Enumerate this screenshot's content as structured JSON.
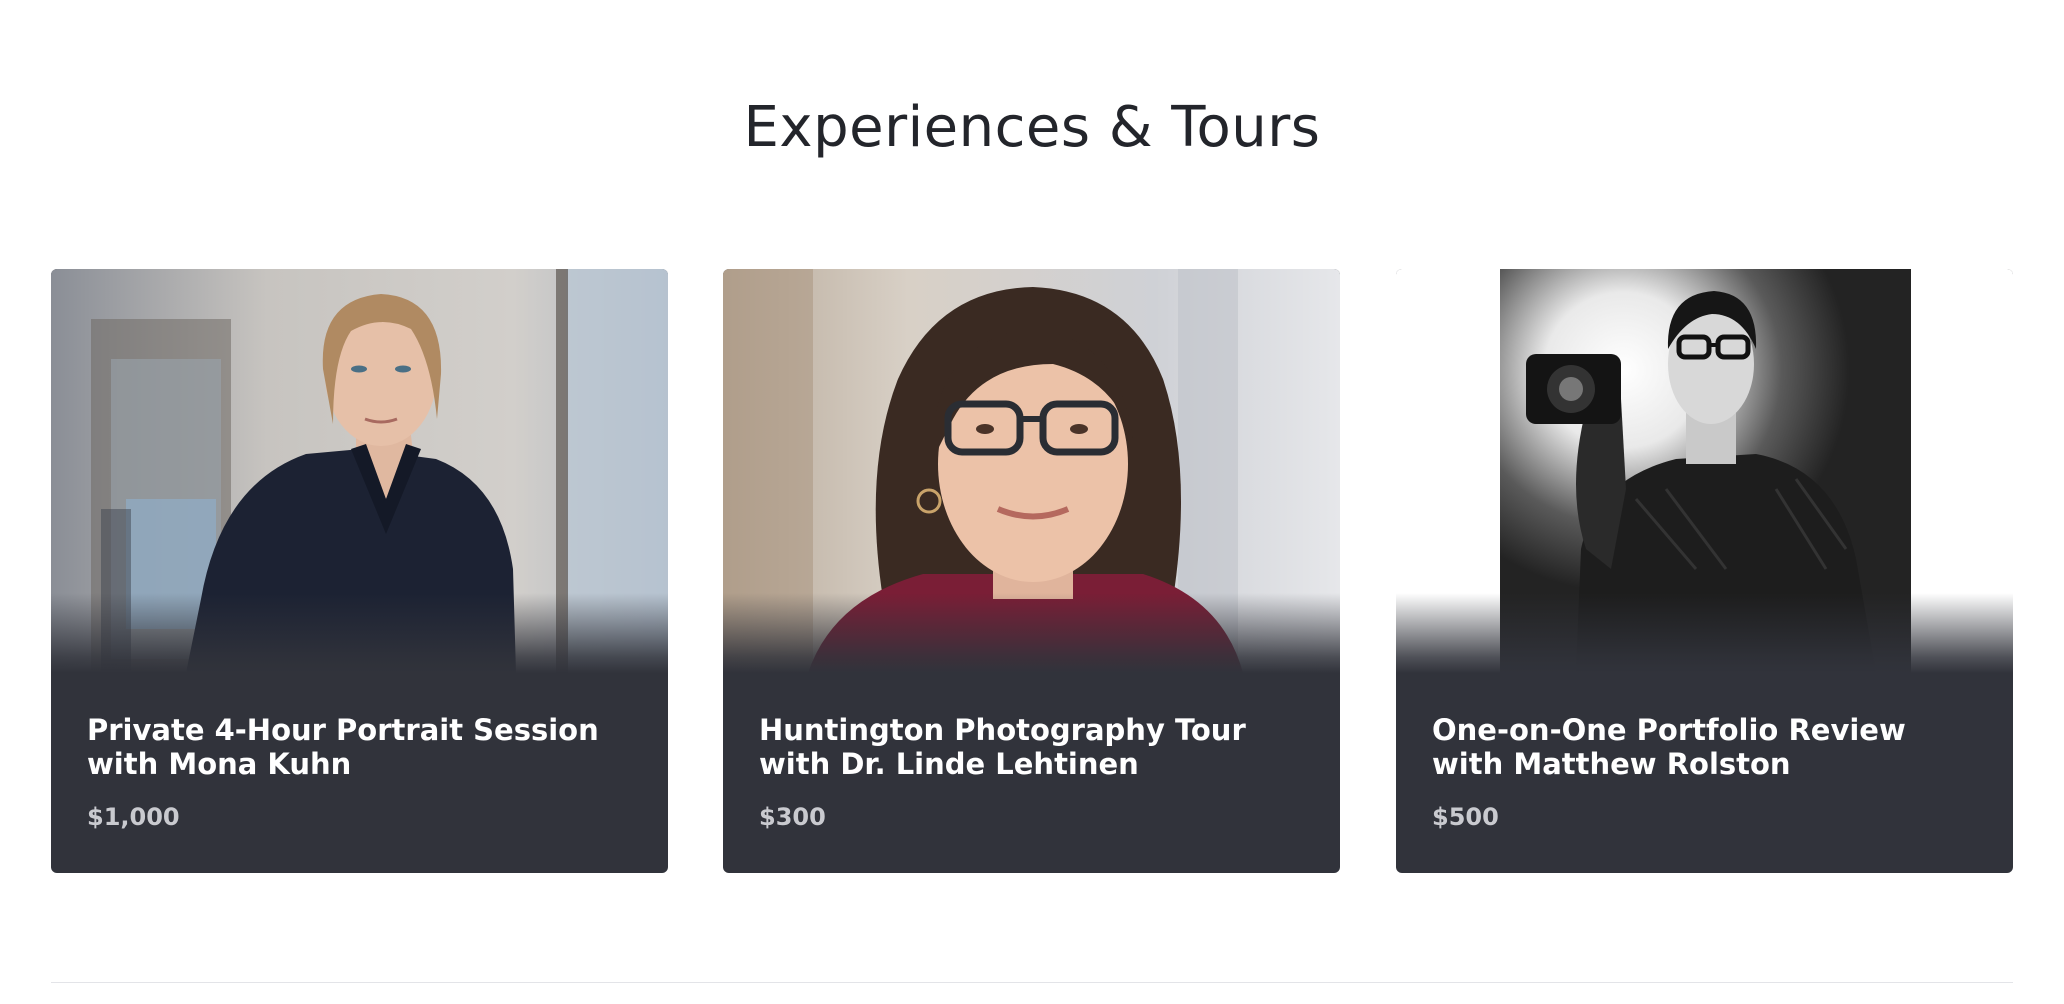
{
  "section": {
    "title": "Experiences & Tours"
  },
  "cards": [
    {
      "title": "Private 4-Hour Portrait Session with Mona Kuhn",
      "price": "$1,000",
      "photo": "portrait-photo"
    },
    {
      "title": "Huntington Photography Tour with Dr. Linde Lehtinen",
      "price": "$300",
      "photo": "portrait-photo"
    },
    {
      "title": "One-on-One Portfolio Review with Matthew Rolston",
      "price": "$500",
      "photo": "portrait-photo"
    }
  ],
  "colors": {
    "card_background": "#31333b",
    "title_text": "#ffffff",
    "price_text": "#c9cacf",
    "heading_text": "#23252b"
  }
}
